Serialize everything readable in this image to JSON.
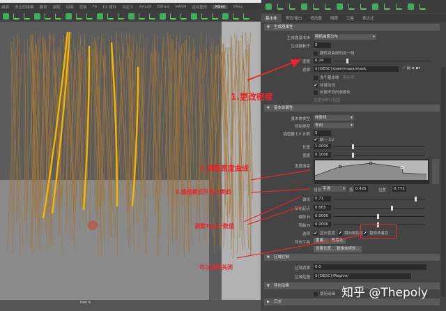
{
  "menubar": {
    "items": [
      "曲面",
      "多边形建模",
      "雕刻",
      "装配",
      "动画",
      "渲染",
      "FX",
      "FX 缓存",
      "自定义",
      "Arnold",
      "Bifrost",
      "MASH",
      "运动图形",
      "XGen",
      "VRay"
    ],
    "active": "XGen"
  },
  "viewport": {
    "label": "tree d"
  },
  "panel": {
    "tabs": [
      "基本体",
      "预览/输出",
      "修改器",
      "梳理",
      "工具",
      "表达式"
    ],
    "generator": {
      "header": "生成器属性",
      "primitive_label": "生成器基本体",
      "primitive_value": "随机曲面分布",
      "seed_label": "生成器种子",
      "seed_value": "0",
      "flip_label": "翻转到曲面的另一侧",
      "density_label": "密度",
      "density_value": "6.24",
      "density_fraction": 0.13,
      "mask_label": "遮罩",
      "mask_value": "${DESC}/paintmaps/mask",
      "multi_label": "多个基本体",
      "multi_btn": "禁用项...",
      "comp1": "补偿法线",
      "comp2": "补偿不同的参数化",
      "create_map": "创建参数化贴图"
    },
    "primitive": {
      "header": "基本体属性",
      "type_label": "基本体类型",
      "type_value": "样条线",
      "control_label": "控制类型",
      "control_value": "导向",
      "cv_label": "插值器 CV 计数",
      "cv_value": "5",
      "uniform_cv": "统一 CV",
      "length_label": "长度",
      "length_value": "1.0000",
      "width_label": "宽度",
      "width_value": "0.1000",
      "ramp_label": "宽度渐变",
      "interp_label": "插值",
      "interp_value": "平滑",
      "val_label": "值",
      "val_value": "0.425",
      "pos_label": "位置",
      "pos_value": "0.772",
      "taper_label": "锥化",
      "taper_value": "0.71",
      "taper_start_label": "锥化起点",
      "taper_start_value": "0.665",
      "offset_label": "偏移 N",
      "offset_value": "0.0000",
      "bend_label": "弯曲 N",
      "bend_value": "0.0000",
      "options_label": "选项",
      "opt1": "显示宽度",
      "opt2": "朝向摄影机",
      "opt3": "替换体着色",
      "guide_tools_label": "导向工具",
      "rebuild": "重建...",
      "normalize": "规格化",
      "set_length": "设置长度...",
      "replace": "替换体修饰..."
    },
    "region": {
      "header": "区域控制",
      "mask_label": "区域遮罩",
      "mask_value": "0.0",
      "map_label": "区域贴图",
      "map_value": "${DESC}/Region/"
    },
    "guide_anim": {
      "header": "导向动画",
      "use_anim": "使用动画"
    },
    "log": {
      "header": "日志"
    }
  },
  "annotations": {
    "a1": "1.更改密度",
    "a2": "2.调整宽度曲线",
    "a3": "3.插值模式平滑之类的",
    "a4": "调整Taper数值",
    "a5": "可以选择关闭"
  },
  "watermark": "知乎 @Thepoly",
  "colors": {
    "annotation": "#e8262b",
    "hair": "#a0753a",
    "guide": "#f5b800"
  }
}
